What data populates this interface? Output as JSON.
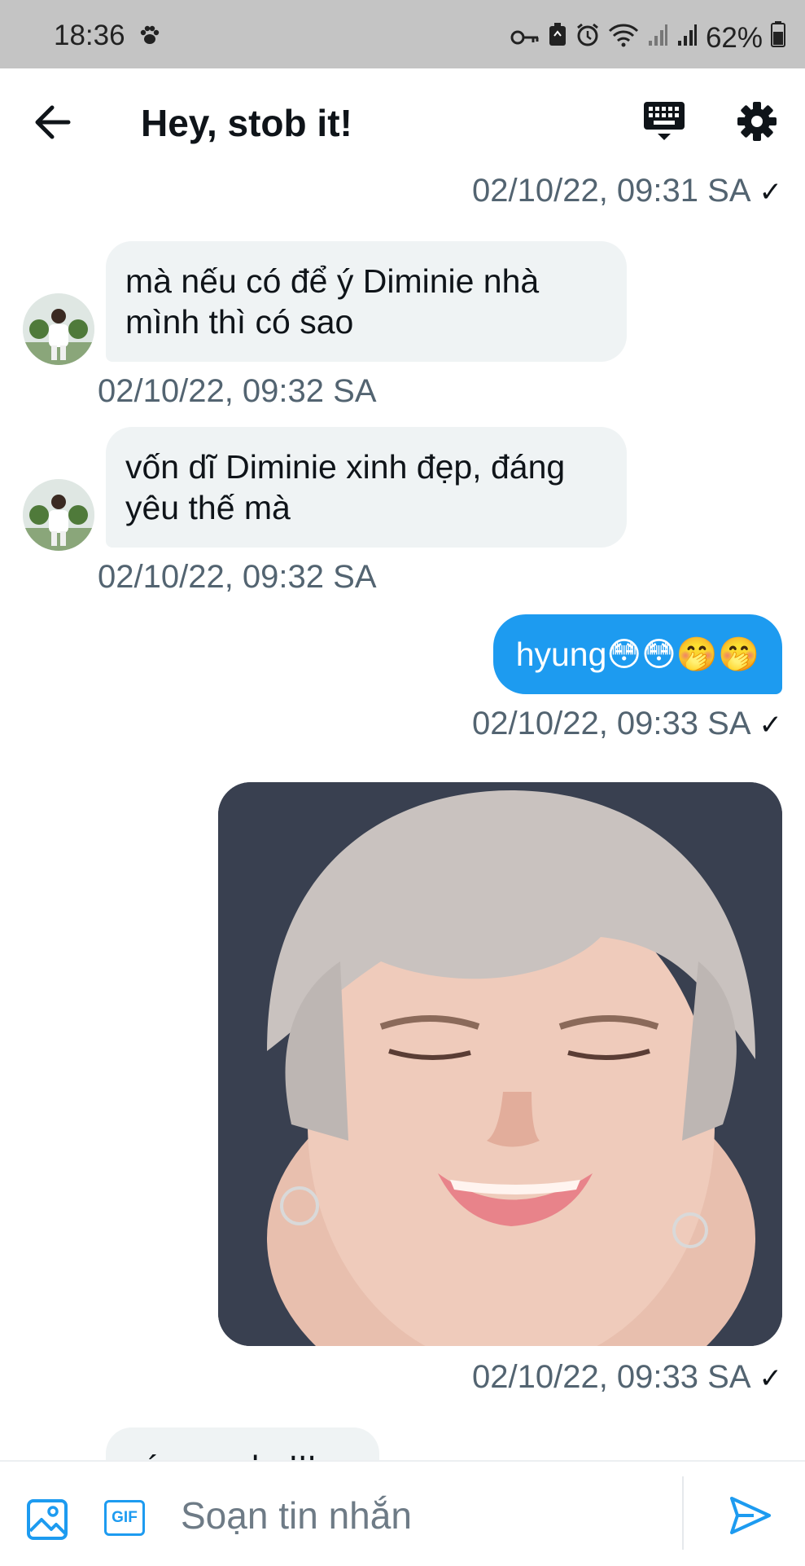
{
  "status_bar": {
    "time": "18:36",
    "battery": "62%"
  },
  "header": {
    "title": "Hey, stob it!"
  },
  "messages": [
    {
      "id": "m0",
      "direction": "out",
      "timestamp": "02/10/22, 09:31 SA",
      "read_mark": "✓"
    },
    {
      "id": "m1",
      "direction": "in",
      "text_line1": "mà nếu có để ý Diminie nhà",
      "text_line2": "mình thì có sao",
      "timestamp": "02/10/22, 09:32 SA"
    },
    {
      "id": "m2",
      "direction": "in",
      "text_line1": "vốn dĩ Diminie xinh đẹp, đáng",
      "text_line2": "yêu thế mà",
      "timestamp": "02/10/22, 09:32 SA"
    },
    {
      "id": "m3",
      "direction": "out",
      "text": "hyung😳😳🤭🤭",
      "timestamp": "02/10/22, 09:33 SA",
      "read_mark": "✓"
    },
    {
      "id": "m4",
      "direction": "out",
      "type": "image",
      "timestamp": "02/10/22, 09:33 SA",
      "read_mark": "✓"
    },
    {
      "id": "m5",
      "direction": "in",
      "text": "có sao nhe!!!"
    }
  ],
  "composer": {
    "placeholder": "Soạn tin nhắn",
    "gif_label": "GIF"
  },
  "colors": {
    "accent": "#1d9bf0",
    "incoming_bubble": "#eff3f4",
    "timestamp": "#536471"
  }
}
